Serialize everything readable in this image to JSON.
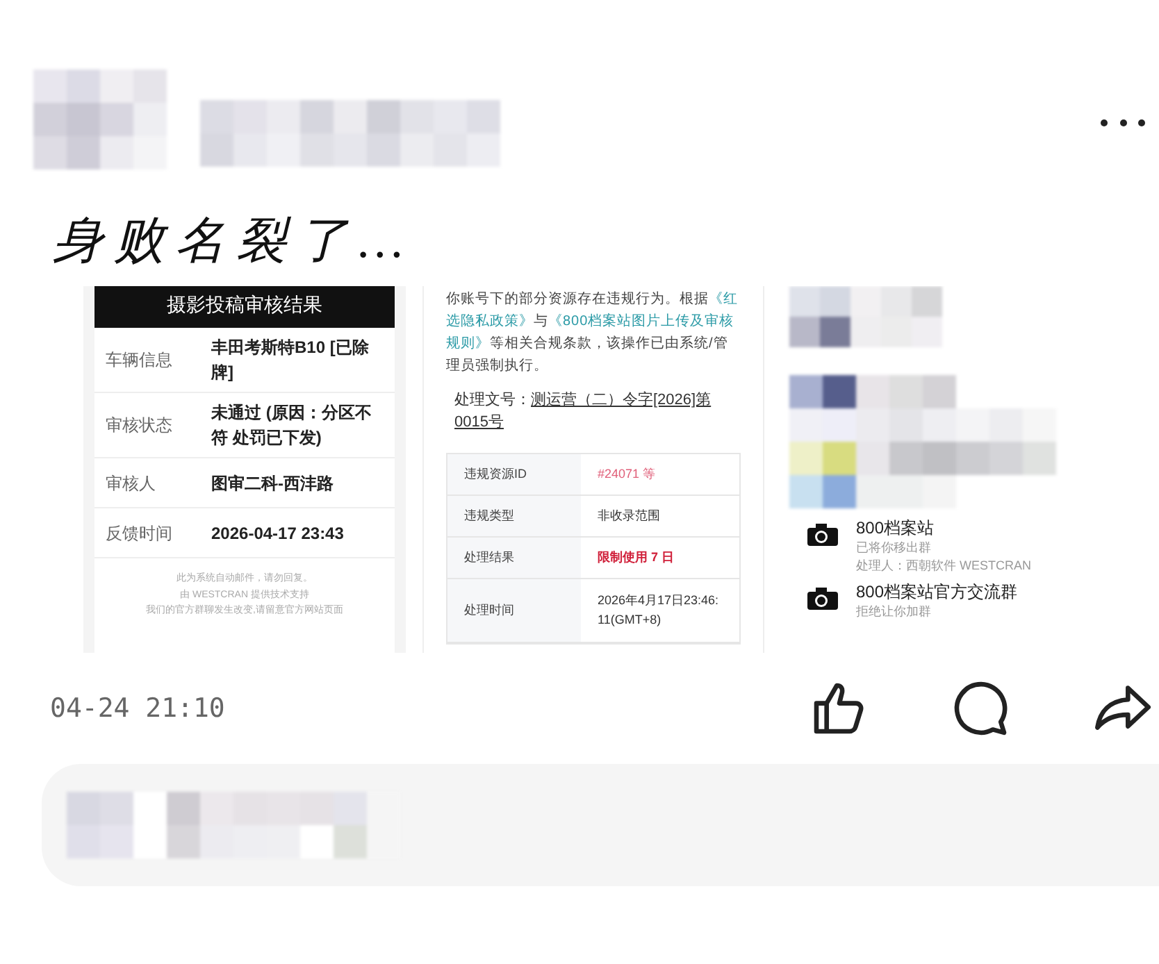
{
  "post": {
    "caption": "身败名裂了…",
    "time": "04-24 21:10"
  },
  "review_card": {
    "title": "摄影投稿审核结果",
    "rows": [
      {
        "label": "车辆信息",
        "value": "丰田考斯特B10 [已除牌]"
      },
      {
        "label": "审核状态",
        "value": "未通过 (原因：分区不符 处罚已下发)"
      },
      {
        "label": "审核人",
        "value": "图审二科-西沣路"
      },
      {
        "label": "反馈时间",
        "value": "2026-04-17 23:43"
      }
    ],
    "footer": [
      "此为系统自动邮件，请勿回复。",
      "由 WESTCRAN 提供技术支持",
      "我们的官方群聊发生改变,请留意官方网站页面"
    ]
  },
  "notice": {
    "paragraph": [
      {
        "text": "你账号下的部分资源存在违规行为。根据",
        "link": false
      },
      {
        "text": "《红选隐私政策》",
        "link": true
      },
      {
        "text": "与",
        "link": false
      },
      {
        "text": "《800档案站图片上传及审核规则》",
        "link": true
      },
      {
        "text": "等相关合规条款，该操作已由系统/管理员强制执行。",
        "link": false
      }
    ],
    "doc_label": "处理文号：",
    "doc_number": "测运营（二）令字[2026]第0015号",
    "rows": [
      {
        "label": "违规资源ID",
        "value": "#24071 等",
        "kind": "pink"
      },
      {
        "label": "违规类型",
        "value": "非收录范围",
        "kind": "plain"
      },
      {
        "label": "处理结果",
        "value": "限制使用 7 日",
        "kind": "alert"
      },
      {
        "label": "处理时间",
        "value": "2026年4月17日23:46:11(GMT+8)",
        "kind": "plain"
      }
    ]
  },
  "group_notices": [
    {
      "title": "800档案站",
      "lines": [
        "已将你移出群",
        "处理人：西朝软件 WESTCRAN"
      ]
    },
    {
      "title": "800档案站官方交流群",
      "lines": [
        "拒绝让你加群"
      ]
    }
  ]
}
